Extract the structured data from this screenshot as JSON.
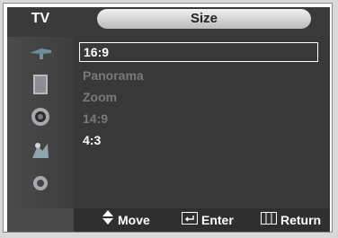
{
  "topbar": {
    "source_label": "TV",
    "title": "Size"
  },
  "sidebar": {
    "icons": [
      "antenna-icon",
      "picture-icon",
      "sound-icon",
      "channel-icon",
      "setup-icon"
    ]
  },
  "menu": {
    "items": [
      {
        "label": "16:9",
        "state": "selected"
      },
      {
        "label": "Panorama",
        "state": "disabled"
      },
      {
        "label": "Zoom",
        "state": "disabled"
      },
      {
        "label": "14:9",
        "state": "disabled"
      },
      {
        "label": "4:3",
        "state": "enabled"
      }
    ]
  },
  "help": {
    "move": "Move",
    "enter": "Enter",
    "return": "Return"
  }
}
